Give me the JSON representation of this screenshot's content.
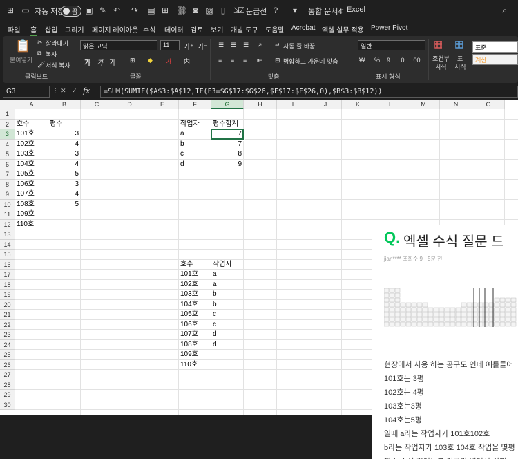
{
  "titlebar": {
    "autosave_label": "자동 저장",
    "autosave_state": "끔",
    "gridlines_label": "눈금선",
    "doc_title": "통합 문서4",
    "app_name": "Excel"
  },
  "menu": [
    "파일",
    "홈",
    "삽입",
    "그리기",
    "페이지 레이아웃",
    "수식",
    "데이터",
    "검토",
    "보기",
    "개발 도구",
    "도움말",
    "Acrobat",
    "엑셀 실무 적용",
    "Power Pivot"
  ],
  "menu_active_index": 1,
  "ribbon": {
    "clipboard": {
      "paste": "붙여넣기",
      "cut": "잘라내기",
      "copy": "복사",
      "format_painter": "서식 복사",
      "label": "클립보드"
    },
    "font": {
      "name": "맑은 고딕",
      "size": "11",
      "bold": "가",
      "italic": "가",
      "underline": "가",
      "label": "글꼴"
    },
    "align": {
      "wrap": "자동 줄 바꿈",
      "merge": "병합하고 가운데 맞춤",
      "label": "맞춤"
    },
    "number": {
      "format": "일반",
      "label": "표시 형식"
    },
    "styles": {
      "cond_format": "조건부",
      "cond_format2": "서식",
      "table": "표",
      "table2": "서식",
      "style_normal": "표준",
      "style_calc": "계산"
    },
    "colors": {
      "accent": "#217346",
      "calc_orange": "#f59d33"
    }
  },
  "formula_bar": {
    "name_box": "G3",
    "formula": "=SUM(SUMIF($A$3:$A$12,IF(F3=$G$17:$G$26,$F$17:$F$26,0),$B$3:$B$12))"
  },
  "columns": [
    "A",
    "B",
    "C",
    "D",
    "E",
    "F",
    "G",
    "H",
    "I",
    "J",
    "K",
    "L",
    "M",
    "N",
    "O"
  ],
  "rows": [
    "1",
    "2",
    "3",
    "4",
    "5",
    "6",
    "7",
    "8",
    "9",
    "10",
    "11",
    "12",
    "13",
    "14",
    "15",
    "16",
    "17",
    "18",
    "19",
    "20",
    "21",
    "22",
    "23",
    "24",
    "25",
    "26",
    "27",
    "28",
    "29",
    "30"
  ],
  "selected": {
    "col": "G",
    "row": "3"
  },
  "table1": {
    "headers": [
      "호수",
      "평수"
    ],
    "rows": [
      [
        "101호",
        "3"
      ],
      [
        "102호",
        "4"
      ],
      [
        "103호",
        "3"
      ],
      [
        "104호",
        "4"
      ],
      [
        "105호",
        "5"
      ],
      [
        "106호",
        "3"
      ],
      [
        "107호",
        "4"
      ],
      [
        "108호",
        "5"
      ],
      [
        "109호",
        ""
      ],
      [
        "110호",
        ""
      ]
    ]
  },
  "table2": {
    "headers": [
      "작업자",
      "평수합계"
    ],
    "rows": [
      [
        "a",
        "7"
      ],
      [
        "b",
        "7"
      ],
      [
        "c",
        "8"
      ],
      [
        "d",
        "9"
      ]
    ]
  },
  "table3": {
    "headers": [
      "호수",
      "작업자"
    ],
    "rows": [
      [
        "101호",
        "a"
      ],
      [
        "102호",
        "a"
      ],
      [
        "103호",
        "b"
      ],
      [
        "104호",
        "b"
      ],
      [
        "105호",
        "c"
      ],
      [
        "106호",
        "c"
      ],
      [
        "107호",
        "d"
      ],
      [
        "108호",
        "d"
      ],
      [
        "109호",
        ""
      ],
      [
        "110호",
        ""
      ]
    ]
  },
  "overlay": {
    "q_mark": "Q.",
    "title": "엑셀 수식 질문 드",
    "author": "jian****",
    "meta": "조회수 9 · 5분 전",
    "lines": [
      "현장에서 사용 하는 공구도 인데 예를들어",
      "101호는 3평",
      "102호는 4평",
      "103호는3평",
      "104호는5평",
      "일때 a라는 작업자가 101호102호",
      "b라는 작업자가 103호 104호 작업을 몇평",
      "평수 수식 걸어놓고 이름만 넣어서 쉽게 :"
    ]
  }
}
